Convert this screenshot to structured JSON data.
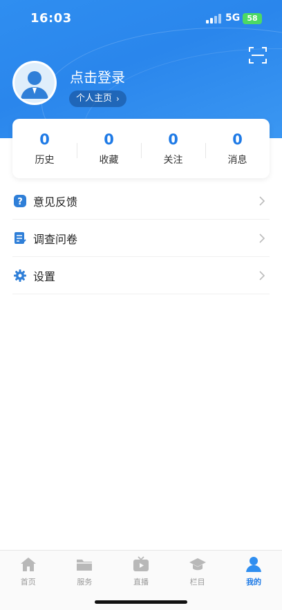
{
  "status_bar": {
    "time": "16:03",
    "network": "5G",
    "battery": "58"
  },
  "profile": {
    "login_text": "点击登录",
    "home_link": "个人主页"
  },
  "stats": [
    {
      "value": "0",
      "label": "历史"
    },
    {
      "value": "0",
      "label": "收藏"
    },
    {
      "value": "0",
      "label": "关注"
    },
    {
      "value": "0",
      "label": "消息"
    }
  ],
  "menu": [
    {
      "label": "意见反馈",
      "icon": "question-icon"
    },
    {
      "label": "调查问卷",
      "icon": "survey-icon"
    },
    {
      "label": "设置",
      "icon": "gear-icon"
    }
  ],
  "tabs": [
    {
      "label": "首页",
      "icon": "home-icon",
      "active": false
    },
    {
      "label": "服务",
      "icon": "folder-icon",
      "active": false
    },
    {
      "label": "直播",
      "icon": "tv-icon",
      "active": false
    },
    {
      "label": "栏目",
      "icon": "graduation-cap-icon",
      "active": false
    },
    {
      "label": "我的",
      "icon": "person-icon",
      "active": true
    }
  ],
  "colors": {
    "primary": "#1e7ae6",
    "header": "#2f8ef0",
    "inactive": "#999999"
  }
}
